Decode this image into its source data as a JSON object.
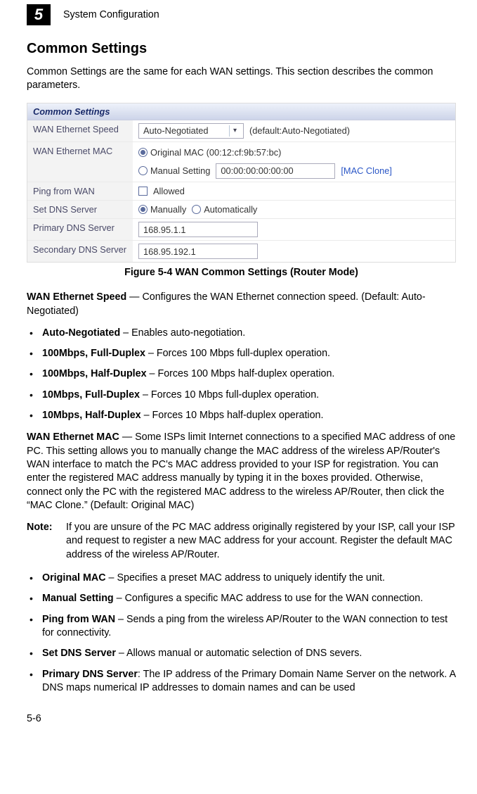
{
  "header": {
    "chapter_number": "5",
    "section_title": "System Configuration"
  },
  "h1": "Common Settings",
  "intro": "Common Settings are the same for each WAN settings. This section describes the common parameters.",
  "panel": {
    "title": "Common Settings",
    "rows": {
      "wan_speed": {
        "label": "WAN Ethernet Speed",
        "value": "Auto-Negotiated",
        "hint": "(default:Auto-Negotiated)"
      },
      "wan_mac": {
        "label": "WAN Ethernet MAC",
        "original_label": "Original MAC (00:12:cf:9b:57:bc)",
        "manual_label": "Manual Setting",
        "manual_value": "00:00:00:00:00:00",
        "clone_link": "[MAC Clone]"
      },
      "ping": {
        "label": "Ping from WAN",
        "allowed_label": "Allowed"
      },
      "set_dns": {
        "label": "Set DNS Server",
        "opt1": "Manually",
        "opt2": "Automatically"
      },
      "primary_dns": {
        "label": "Primary DNS Server",
        "value": "168.95.1.1"
      },
      "secondary_dns": {
        "label": "Secondary DNS Server",
        "value": "168.95.192.1"
      }
    }
  },
  "caption": "Figure 5-4  WAN Common Settings (Router Mode)",
  "wan_speed_desc_bold": "WAN Ethernet Speed",
  "wan_speed_desc_rest": " — Configures the WAN Ethernet connection speed. (Default: Auto-Negotiated)",
  "speed_bullets": [
    {
      "b": "Auto-Negotiated",
      "t": " – Enables auto-negotiation."
    },
    {
      "b": "100Mbps, Full-Duplex",
      "t": " – Forces 100 Mbps full-duplex operation."
    },
    {
      "b": "100Mbps, Half-Duplex",
      "t": " – Forces 100 Mbps half-duplex operation."
    },
    {
      "b": "10Mbps, Full-Duplex",
      "t": " – Forces 10 Mbps full-duplex operation."
    },
    {
      "b": "10Mbps, Half-Duplex",
      "t": " – Forces 10 Mbps half-duplex operation."
    }
  ],
  "wan_mac_desc_bold": "WAN Ethernet MAC",
  "wan_mac_desc_rest": " — Some ISPs limit Internet connections to a specified MAC address of one PC. This setting allows you to manually change the MAC address of the wireless AP/Router's WAN interface to match the PC's MAC address provided to your ISP for registration. You can enter the registered MAC address manually by typing it in the boxes provided. Otherwise, connect only the PC with the registered MAC address to the wireless AP/Router, then click the “MAC Clone.” (Default: Original MAC)",
  "note_label": "Note:",
  "note_text": "If you are unsure of the PC MAC address originally registered by your ISP, call your ISP and request to register a new MAC address for your account. Register the default MAC address of the wireless AP/Router.",
  "lower_bullets": [
    {
      "b": "Original MAC",
      "t": " – Specifies a preset MAC address to uniquely identify the unit."
    },
    {
      "b": "Manual Setting",
      "t": " – Configures a specific MAC address to use for the WAN connection."
    },
    {
      "b": "Ping from WAN",
      "t": " – Sends a ping from the wireless AP/Router to the WAN connection to test for connectivity."
    },
    {
      "b": "Set DNS Server",
      "t": " – Allows manual or automatic selection of DNS severs."
    },
    {
      "b": "Primary DNS Server",
      "t": ": The IP address of the Primary Domain Name Server on the network. A DNS maps numerical IP addresses to domain names and can be used"
    }
  ],
  "footer": "5-6"
}
